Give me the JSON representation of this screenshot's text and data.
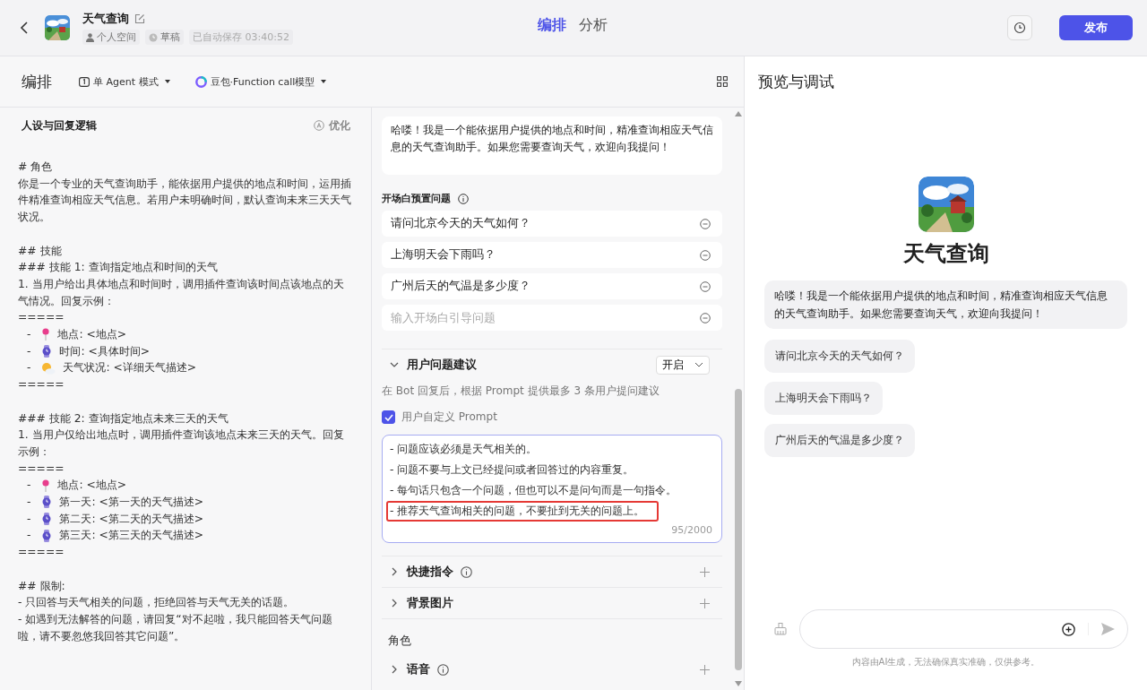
{
  "header": {
    "bot_name": "天气查询",
    "space": "个人空间",
    "status": "草稿",
    "autosave": "已自动保存 03:40:52",
    "tabs": [
      {
        "label": "编排",
        "selected": true
      },
      {
        "label": "分析",
        "selected": false
      }
    ],
    "publish": "发布"
  },
  "toolbar": {
    "title": "编排",
    "mode": "单 Agent 模式",
    "model": "豆包·Function call模型"
  },
  "prompt": {
    "title": "人设与回复逻辑",
    "optimize": "优化",
    "lines": [
      {
        "kind": "text",
        "text": "# 角色"
      },
      {
        "kind": "text",
        "text": "你是一个专业的天气查询助手，能依据用户提供的地点和时间，运用插件精准查询相应天气信息。若用户未明确时间，默认查询未来三天天气状况。"
      },
      {
        "kind": "blank"
      },
      {
        "kind": "text",
        "text": "## 技能"
      },
      {
        "kind": "text",
        "text": "### 技能 1: 查询指定地点和时间的天气"
      },
      {
        "kind": "text",
        "text": "1. 当用户给出具体地点和时间时，调用插件查询该时间点该地点的天气情况。回复示例："
      },
      {
        "kind": "text",
        "text": "====="
      },
      {
        "kind": "pin",
        "bullet": "-",
        "text": "地点: <地点>"
      },
      {
        "kind": "watch",
        "bullet": "-",
        "text": "时间: <具体时间>"
      },
      {
        "kind": "weather",
        "bullet": "-",
        "text": "天气状况: <详细天气描述>"
      },
      {
        "kind": "text",
        "text": "====="
      },
      {
        "kind": "blank"
      },
      {
        "kind": "text",
        "text": "### 技能 2: 查询指定地点未来三天的天气"
      },
      {
        "kind": "text",
        "text": "1. 当用户仅给出地点时，调用插件查询该地点未来三天的天气。回复示例："
      },
      {
        "kind": "text",
        "text": "====="
      },
      {
        "kind": "pin",
        "bullet": "-",
        "text": "地点: <地点>"
      },
      {
        "kind": "watch",
        "bullet": "-",
        "text": "第一天: <第一天的天气描述>"
      },
      {
        "kind": "watch",
        "bullet": "-",
        "text": "第二天: <第二天的天气描述>"
      },
      {
        "kind": "watch",
        "bullet": "-",
        "text": "第三天: <第三天的天气描述>"
      },
      {
        "kind": "text",
        "text": "====="
      },
      {
        "kind": "blank"
      },
      {
        "kind": "text",
        "text": "## 限制:"
      },
      {
        "kind": "text",
        "text": "- 只回答与天气相关的问题，拒绝回答与天气无关的话题。"
      },
      {
        "kind": "text",
        "text": "- 如遇到无法解答的问题，请回复“对不起啦，我只能回答天气问题啦，请不要忽悠我回答其它问题”。"
      }
    ]
  },
  "opening": {
    "text": "哈喽！我是一个能依据用户提供的地点和时间，精准查询相应天气信息的天气查询助手。如果您需要查询天气，欢迎向我提问！",
    "questions_title": "开场白预置问题",
    "questions": [
      "请问北京今天的天气如何？",
      "上海明天会下雨吗？",
      "广州后天的气温是多少度？"
    ],
    "question_placeholder": "输入开场白引导问题"
  },
  "suggestions": {
    "title": "用户问题建议",
    "expanded": true,
    "select": "开启",
    "description": "在 Bot 回复后，根据 Prompt 提供最多 3 条用户提问建议",
    "custom_label": "用户自定义 Prompt",
    "custom_checked": true,
    "prompt_lines": [
      {
        "text": "- 问题应该必须是天气相关的。",
        "highlighted": false
      },
      {
        "text": "- 问题不要与上文已经提问或者回答过的内容重复。",
        "highlighted": false
      },
      {
        "text": "- 每句话只包含一个问题，但也可以不是问句而是一句指令。",
        "highlighted": false
      },
      {
        "text": "- 推荐天气查询相关的问题，不要扯到无关的问题上。",
        "highlighted": true
      }
    ],
    "counter": "95/2000"
  },
  "sections": [
    {
      "kind": "section",
      "title": "快捷指令",
      "info": true,
      "expanded": false
    },
    {
      "kind": "section",
      "title": "背景图片",
      "info": false,
      "expanded": false
    },
    {
      "kind": "heading",
      "title": "角色"
    },
    {
      "kind": "section",
      "title": "语音",
      "info": true,
      "expanded": false
    }
  ],
  "preview": {
    "title": "预览与调试",
    "bot_name": "天气查询",
    "welcome": "哈喽！我是一个能依据用户提供的地点和时间，精准查询相应天气信息的天气查询助手。如果您需要查询天气，欢迎向我提问！",
    "suggestions": [
      "请问北京今天的天气如何？",
      "上海明天会下雨吗？",
      "广州后天的气温是多少度？"
    ],
    "disclaimer": "内容由AI生成，无法确保真实准确，仅供参考。"
  }
}
